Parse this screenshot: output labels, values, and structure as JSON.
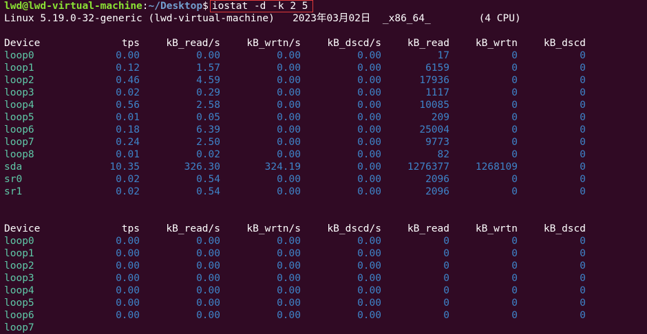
{
  "prompt": {
    "user_host": "lwd@lwd-virtual-machine",
    "separator": ":",
    "path": "~/Desktop",
    "symbol": "$",
    "command": "iostat -d -k 2 5"
  },
  "sysinfo": {
    "kernel": "Linux 5.19.0-32-generic",
    "host": "(lwd-virtual-machine)",
    "date": "2023年03月02日",
    "arch": "_x86_64_",
    "cpu": "(4 CPU)"
  },
  "columns": [
    "Device",
    "tps",
    "kB_read/s",
    "kB_wrtn/s",
    "kB_dscd/s",
    "kB_read",
    "kB_wrtn",
    "kB_dscd"
  ],
  "report1": [
    [
      "loop0",
      "0.00",
      "0.00",
      "0.00",
      "0.00",
      "17",
      "0",
      "0"
    ],
    [
      "loop1",
      "0.12",
      "1.57",
      "0.00",
      "0.00",
      "6159",
      "0",
      "0"
    ],
    [
      "loop2",
      "0.46",
      "4.59",
      "0.00",
      "0.00",
      "17936",
      "0",
      "0"
    ],
    [
      "loop3",
      "0.02",
      "0.29",
      "0.00",
      "0.00",
      "1117",
      "0",
      "0"
    ],
    [
      "loop4",
      "0.56",
      "2.58",
      "0.00",
      "0.00",
      "10085",
      "0",
      "0"
    ],
    [
      "loop5",
      "0.01",
      "0.05",
      "0.00",
      "0.00",
      "209",
      "0",
      "0"
    ],
    [
      "loop6",
      "0.18",
      "6.39",
      "0.00",
      "0.00",
      "25004",
      "0",
      "0"
    ],
    [
      "loop7",
      "0.24",
      "2.50",
      "0.00",
      "0.00",
      "9773",
      "0",
      "0"
    ],
    [
      "loop8",
      "0.01",
      "0.02",
      "0.00",
      "0.00",
      "82",
      "0",
      "0"
    ],
    [
      "sda",
      "10.35",
      "326.30",
      "324.19",
      "0.00",
      "1276377",
      "1268109",
      "0"
    ],
    [
      "sr0",
      "0.02",
      "0.54",
      "0.00",
      "0.00",
      "2096",
      "0",
      "0"
    ],
    [
      "sr1",
      "0.02",
      "0.54",
      "0.00",
      "0.00",
      "2096",
      "0",
      "0"
    ]
  ],
  "report2": [
    [
      "loop0",
      "0.00",
      "0.00",
      "0.00",
      "0.00",
      "0",
      "0",
      "0"
    ],
    [
      "loop1",
      "0.00",
      "0.00",
      "0.00",
      "0.00",
      "0",
      "0",
      "0"
    ],
    [
      "loop2",
      "0.00",
      "0.00",
      "0.00",
      "0.00",
      "0",
      "0",
      "0"
    ],
    [
      "loop3",
      "0.00",
      "0.00",
      "0.00",
      "0.00",
      "0",
      "0",
      "0"
    ],
    [
      "loop4",
      "0.00",
      "0.00",
      "0.00",
      "0.00",
      "0",
      "0",
      "0"
    ],
    [
      "loop5",
      "0.00",
      "0.00",
      "0.00",
      "0.00",
      "0",
      "0",
      "0"
    ],
    [
      "loop6",
      "0.00",
      "0.00",
      "0.00",
      "0.00",
      "0",
      "0",
      "0"
    ],
    [
      "loop7",
      "",
      "",
      "",
      "",
      "",
      "",
      ""
    ]
  ],
  "colors": {
    "background": "#300a24",
    "prompt_user": "#8ae234",
    "prompt_path": "#729fcf",
    "device": "#5fc9a8",
    "value": "#3e84c9",
    "highlight_box": "#e23b3b"
  }
}
